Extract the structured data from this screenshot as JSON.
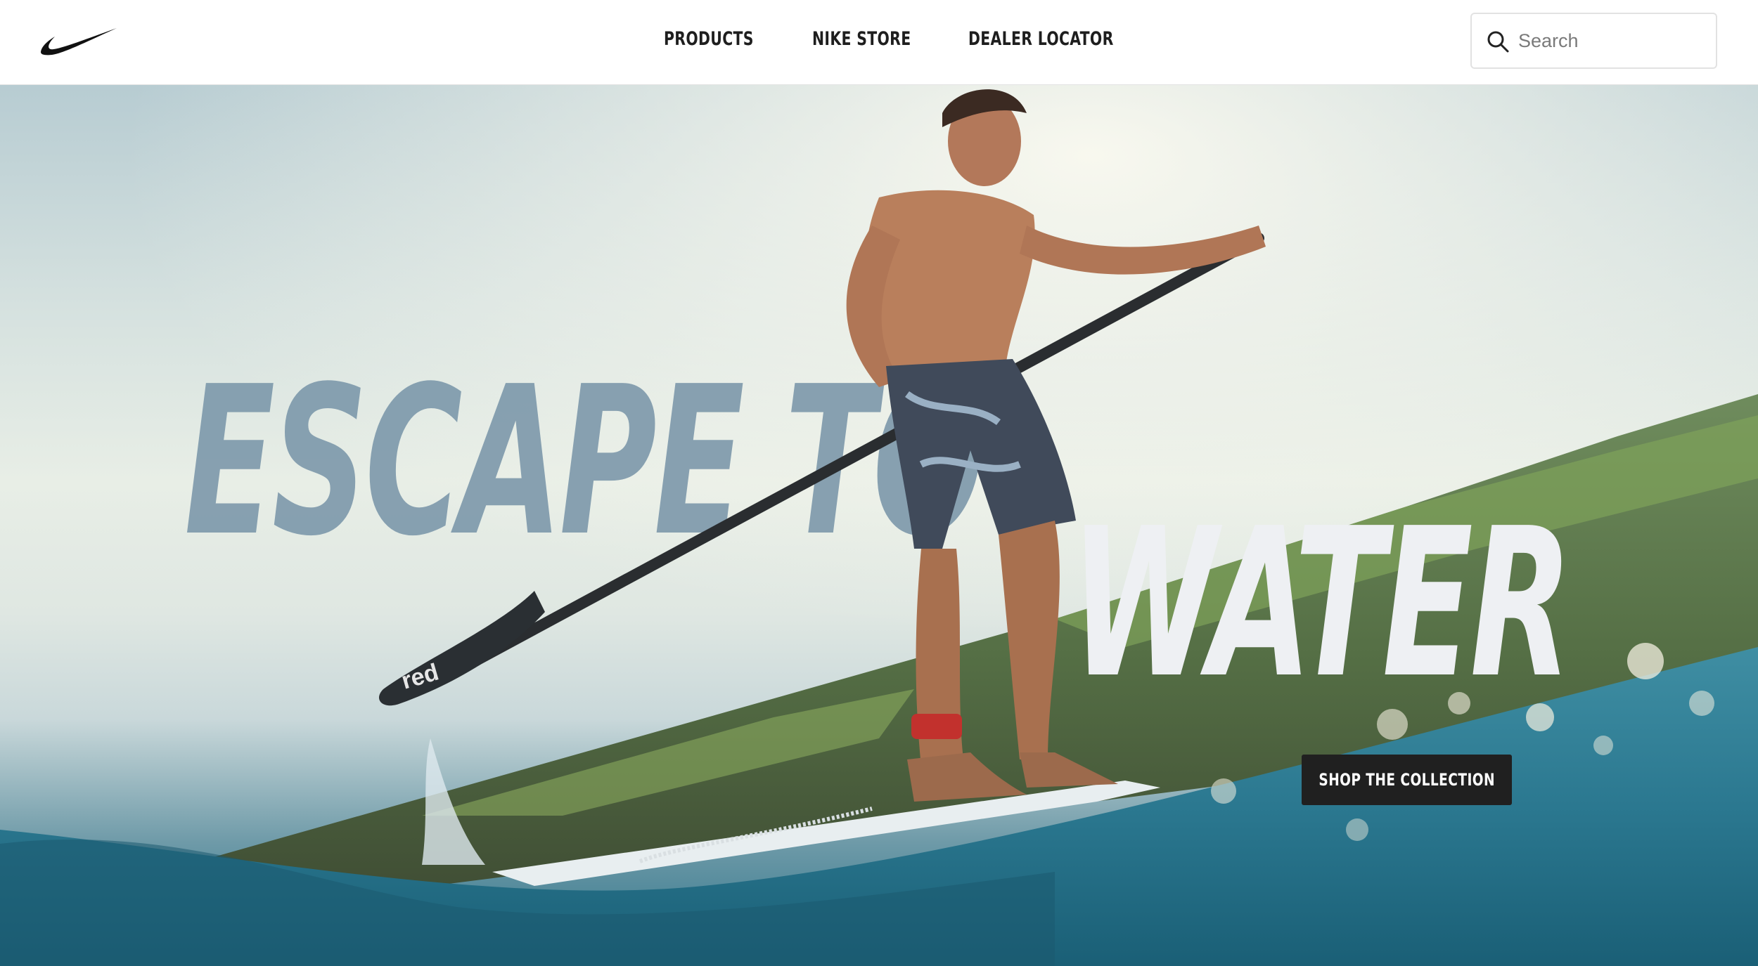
{
  "header": {
    "logo_icon": "nike-swoosh-icon",
    "nav": [
      {
        "label": "PRODUCTS"
      },
      {
        "label": "NIKE STORE"
      },
      {
        "label": "DEALER LOCATOR"
      }
    ],
    "search": {
      "placeholder": "Search",
      "value": "",
      "icon": "search-icon"
    }
  },
  "hero": {
    "headline_line1": "ESCAPE TO",
    "headline_line2": "WATER",
    "paddle_brand": "red",
    "cta_label": "SHOP THE COLLECTION"
  },
  "colors": {
    "nav_text": "#1e1e1e",
    "headline_blue": "#7f9aac",
    "headline_white": "#eef0f3",
    "cta_background": "#202020",
    "water": "#2d7389"
  }
}
